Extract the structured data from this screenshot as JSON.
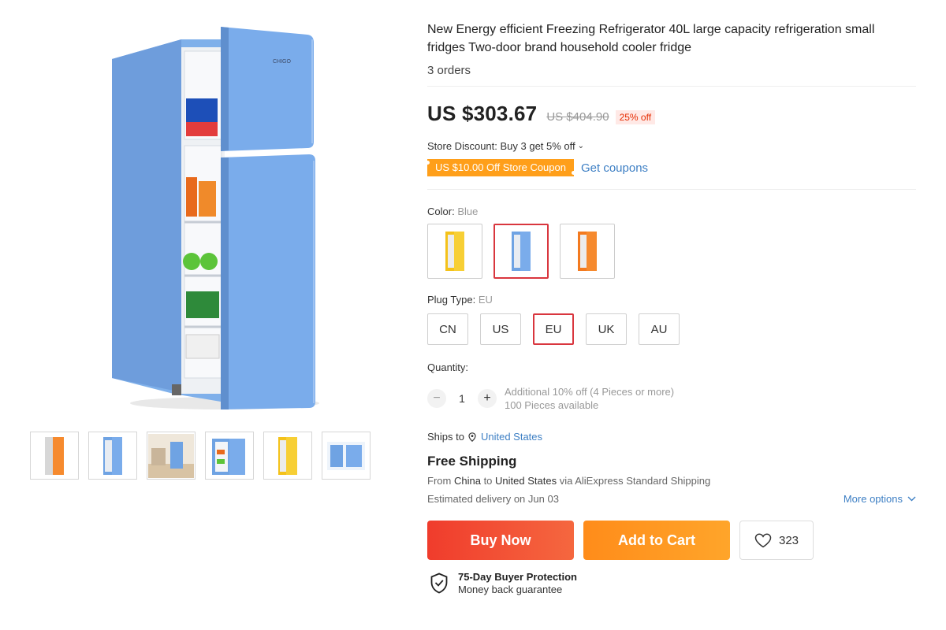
{
  "product": {
    "title": "New Energy efficient Freezing Refrigerator 40L large capacity refrigeration small fridges Two-door brand household cooler fridge",
    "orders": "3 orders",
    "brand_logo_text": "CHIGO"
  },
  "price": {
    "current": "US $303.67",
    "original": "US $404.90",
    "discount": "25% off"
  },
  "store_discount": {
    "text": "Store Discount: Buy 3 get 5% off",
    "chevron": "⌄"
  },
  "coupon": {
    "label": "US $10.00 Off Store Coupon",
    "link": "Get coupons"
  },
  "color": {
    "label": "Color:",
    "selected": "Blue",
    "options": [
      {
        "name": "yellow",
        "hex": "#f4c21a"
      },
      {
        "name": "blue",
        "hex": "#6fa3e3"
      },
      {
        "name": "orange",
        "hex": "#f37a1f"
      }
    ]
  },
  "plug": {
    "label": "Plug Type:",
    "selected": "EU",
    "options": [
      "CN",
      "US",
      "EU",
      "UK",
      "AU"
    ]
  },
  "quantity": {
    "label": "Quantity:",
    "minus": "−",
    "value": "1",
    "plus": "+",
    "note1": "Additional 10% off (4 Pieces or more)",
    "note2": "100 Pieces available"
  },
  "shipping": {
    "ships_to_label": "Ships to",
    "country": "United States",
    "title": "Free Shipping",
    "from_prefix": "From",
    "from": "China",
    "to_word": "to",
    "to": "United States",
    "via": "via AliExpress Standard Shipping",
    "delivery": "Estimated delivery on Jun 03",
    "more_options": "More options"
  },
  "actions": {
    "buy_now": "Buy Now",
    "add_to_cart": "Add to Cart",
    "wishlist_count": "323"
  },
  "protection": {
    "title": "75-Day Buyer Protection",
    "subtitle": "Money back guarantee"
  },
  "colors": {
    "accent_red": "#d9363e",
    "link_blue": "#3d7fc4",
    "coupon_orange": "#ff9f1a",
    "fridge_blue": "#6fa3e3"
  },
  "gallery": {
    "thumbnails": [
      {
        "name": "orange-fridge",
        "hex": "#f37a1f"
      },
      {
        "name": "blue-fridge",
        "hex": "#6fa3e3"
      },
      {
        "name": "room-scene",
        "hex": "#6fa3e3"
      },
      {
        "name": "blue-fridge-open",
        "hex": "#6fa3e3"
      },
      {
        "name": "yellow-fridge",
        "hex": "#f4c21a"
      },
      {
        "name": "blue-fridge-detail",
        "hex": "#6fa3e3"
      }
    ]
  }
}
